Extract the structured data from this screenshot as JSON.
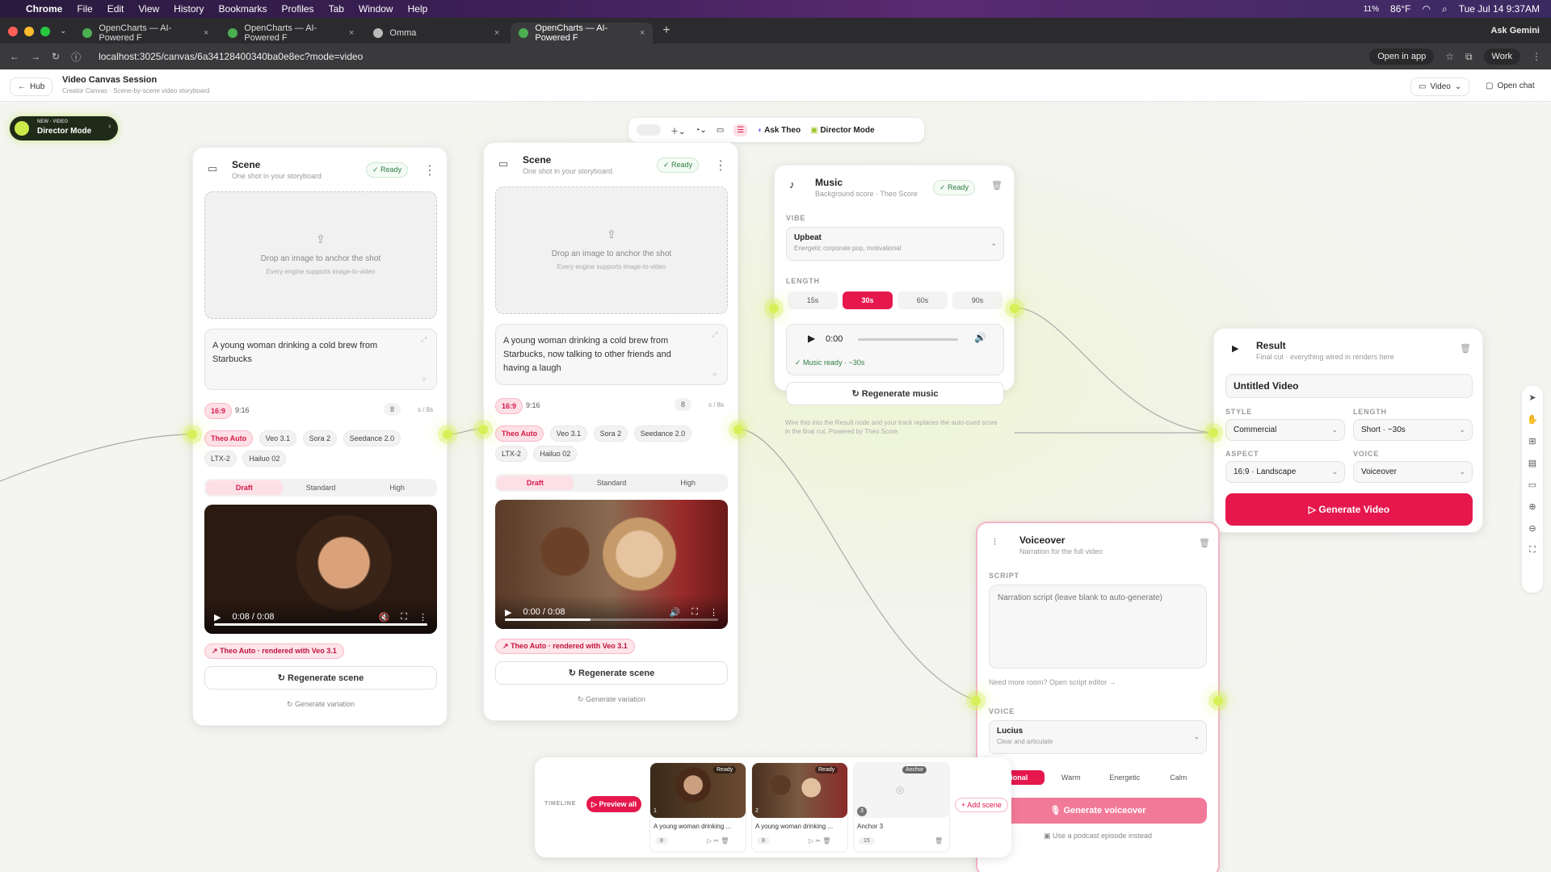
{
  "menubar": {
    "app": "Chrome",
    "items": [
      "File",
      "Edit",
      "View",
      "History",
      "Bookmarks",
      "Profiles",
      "Tab",
      "Window",
      "Help"
    ],
    "weather": "86°F",
    "cpu": "11%",
    "clock": "Tue Jul 14  9:37AM",
    "assistant": "Ask Gemini"
  },
  "browser": {
    "tabs": [
      {
        "label": "OpenCharts — AI-Powered F"
      },
      {
        "label": "OpenCharts — AI-Powered F"
      },
      {
        "label": "Omma"
      },
      {
        "label": "OpenCharts — AI-Powered F"
      }
    ],
    "url": "localhost:3025/canvas/6a34128400340ba0e8ec?mode=video",
    "open_in_app": "Open in app",
    "profile": "Work"
  },
  "header": {
    "back": "Hub",
    "title": "Video Canvas Session",
    "subtitle": "Creator Canvas · Scene-by-scene video storyboard",
    "mode": "Video",
    "open_chat": "Open chat"
  },
  "toolbar": {
    "ask_theo": "Ask Theo",
    "director_mode": "Director Mode"
  },
  "promo": {
    "tag": "NEW · VIDEO",
    "label": "Director Mode"
  },
  "scenes": [
    {
      "title": "Scene",
      "subtitle": "One shot in your storyboard",
      "status": "Ready",
      "drop_title": "Drop an image to anchor the shot",
      "drop_sub": "Every engine supports image-to-video",
      "prompt": "A young woman drinking a cold brew from Starbucks",
      "aspect": [
        "16:9",
        "9:16"
      ],
      "duration": "8",
      "duration_unit": "s / 8s",
      "engines": [
        "Theo Auto",
        "Veo 3.1",
        "Sora 2",
        "Seedance 2.0",
        "LTX-2",
        "Hailuo 02"
      ],
      "quality": [
        "Draft",
        "Standard",
        "High"
      ],
      "time": "0:08 / 0:08",
      "progress": 1.0,
      "rendered": "Theo Auto · rendered with Veo 3.1",
      "regen": "Regenerate scene",
      "variation": "Generate variation"
    },
    {
      "title": "Scene",
      "subtitle": "One shot in your storyboard",
      "status": "Ready",
      "drop_title": "Drop an image to anchor the shot",
      "drop_sub": "Every engine supports image-to-video",
      "prompt": "A young woman drinking a cold brew from Starbucks, now talking to other friends and having a laugh",
      "aspect": [
        "16:9",
        "9:16"
      ],
      "duration": "8",
      "duration_unit": "s / 8s",
      "engines": [
        "Theo Auto",
        "Veo 3.1",
        "Sora 2",
        "Seedance 2.0",
        "LTX-2",
        "Hailuo 02"
      ],
      "quality": [
        "Draft",
        "Standard",
        "High"
      ],
      "time": "0:00 / 0:08",
      "progress": 0.4,
      "rendered": "Theo Auto · rendered with Veo 3.1",
      "regen": "Regenerate scene",
      "variation": "Generate variation"
    }
  ],
  "music": {
    "title": "Music",
    "subtitle": "Background score · Theo Score",
    "status": "Ready",
    "vibe_label": "VIBE",
    "vibe": "Upbeat",
    "vibe_desc": "Energetic corporate pop, motivational",
    "length_label": "LENGTH",
    "lengths": [
      "15s",
      "30s",
      "60s",
      "90s"
    ],
    "time": "0:00",
    "ready_text": "Music ready · ~30s",
    "regen": "Regenerate music",
    "note": "Wire this into the Result node and your track replaces the auto-cued score in the final cut. Powered by Theo Score."
  },
  "result": {
    "title": "Result",
    "subtitle": "Final cut · everything wired in renders here",
    "name": "Untitled Video",
    "style_label": "STYLE",
    "style": "Commercial",
    "length_label": "LENGTH",
    "length": "Short · ~30s",
    "aspect_label": "ASPECT",
    "aspect": "16:9 · Landscape",
    "voice_label": "VOICE",
    "voice": "Voiceover",
    "generate": "Generate Video"
  },
  "voiceover": {
    "title": "Voiceover",
    "subtitle": "Narration for the full video",
    "script_label": "SCRIPT",
    "script_placeholder": "Narration script (leave blank to auto-generate)",
    "more_room": "Need more room? Open script editor →",
    "voice_label": "VOICE",
    "voice": "Lucius",
    "voice_desc": "Clear and articulate",
    "tones": [
      "sional",
      "Warm",
      "Energetic",
      "Calm"
    ],
    "generate": "Generate voiceover",
    "podcast": "Use a podcast episode instead"
  },
  "timeline": {
    "label": "TIMELINE",
    "preview": "Preview all",
    "add_scene": "+ Add scene",
    "clips": [
      {
        "num": "1",
        "caption": "A young woman drinking ...",
        "dur": "8",
        "status": "Ready"
      },
      {
        "num": "2",
        "caption": "A young woman drinking ...",
        "dur": "8",
        "status": "Ready"
      },
      {
        "num": "3",
        "caption": "Anchor 3",
        "dur": "15",
        "status": "Anchor"
      }
    ]
  },
  "colors": {
    "accent": "#e5174d",
    "node": "#d7f05a",
    "ready": "#2e7d45"
  }
}
